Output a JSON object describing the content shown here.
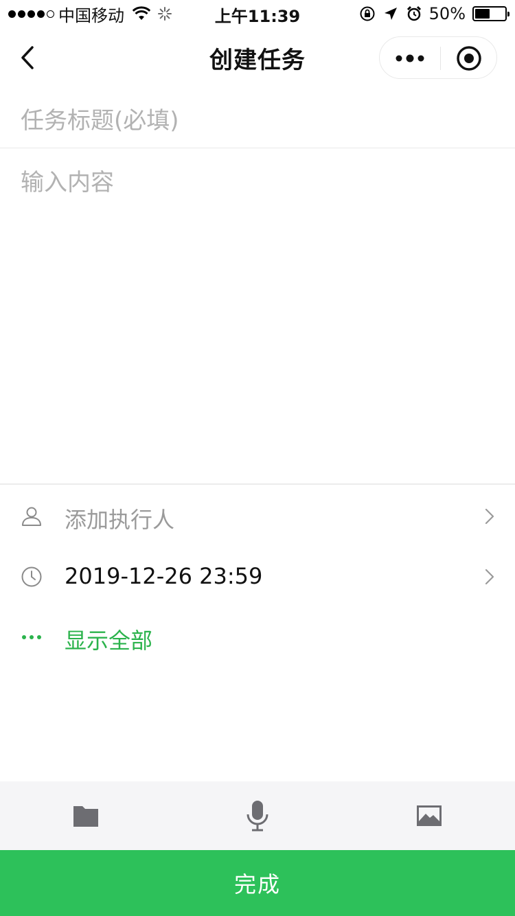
{
  "status_bar": {
    "carrier": "中国移动",
    "time": "上午11:39",
    "battery_percent_label": "50%",
    "battery_level": 0.5,
    "icons": [
      "signal-icon",
      "wifi-icon",
      "activity-icon",
      "rotation-lock-icon",
      "location-icon",
      "alarm-icon",
      "battery-icon"
    ]
  },
  "nav": {
    "title": "创建任务",
    "icons": [
      "back-chevron-icon",
      "more-dots-icon",
      "record-circle-icon"
    ]
  },
  "form": {
    "title_placeholder": "任务标题(必填)",
    "content_placeholder": "输入内容"
  },
  "options": {
    "assignee_label": "添加执行人",
    "deadline_value": "2019-12-26 23:59",
    "show_all_label": "显示全部",
    "icons": [
      "person-icon",
      "clock-icon",
      "more-dots-icon",
      "chevron-right-icon"
    ]
  },
  "toolbar": {
    "icons": [
      "folder-icon",
      "microphone-icon",
      "image-icon"
    ]
  },
  "actions": {
    "done_label": "完成"
  },
  "colors": {
    "accent_green": "#2dc15a",
    "link_green": "#2bb34c",
    "placeholder_gray": "#b2b2b2",
    "toolbar_bg": "#f5f5f7",
    "icon_gray": "#6d6d72"
  }
}
